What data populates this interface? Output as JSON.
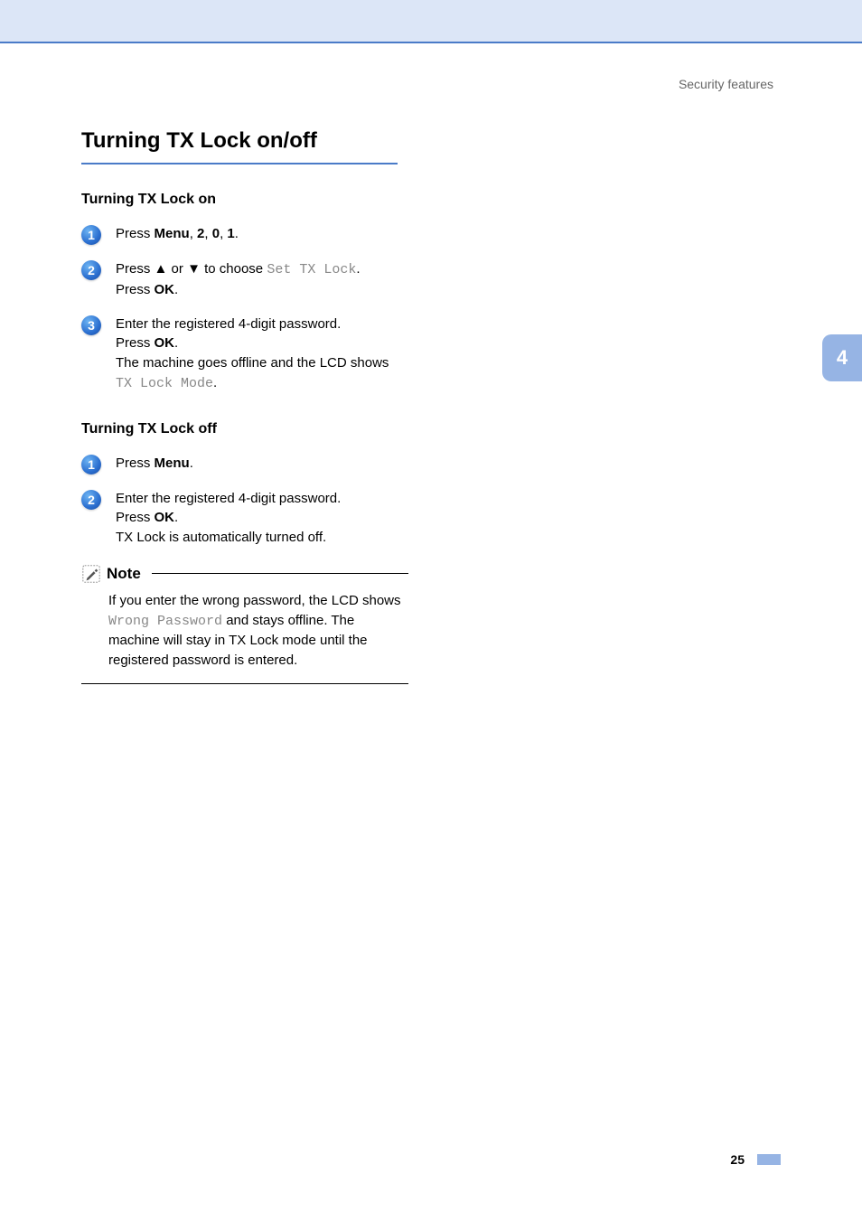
{
  "breadcrumb": "Security features",
  "mainHeading": "Turning TX Lock on/off",
  "sectionOn": {
    "heading": "Turning TX Lock on",
    "steps": [
      {
        "num": "1",
        "parts": [
          {
            "t": "Press "
          },
          {
            "b": "Menu"
          },
          {
            "t": ", "
          },
          {
            "b": "2"
          },
          {
            "t": ", "
          },
          {
            "b": "0"
          },
          {
            "t": ", "
          },
          {
            "b": "1"
          },
          {
            "t": "."
          }
        ]
      },
      {
        "num": "2",
        "parts": [
          {
            "t": "Press "
          },
          {
            "b": "▲"
          },
          {
            "t": " or "
          },
          {
            "b": "▼"
          },
          {
            "t": " to choose "
          },
          {
            "m": "Set TX Lock"
          },
          {
            "t": "."
          },
          {
            "br": true
          },
          {
            "t": "Press "
          },
          {
            "b": "OK"
          },
          {
            "t": "."
          }
        ]
      },
      {
        "num": "3",
        "parts": [
          {
            "t": "Enter the registered 4-digit password."
          },
          {
            "br": true
          },
          {
            "t": "Press "
          },
          {
            "b": "OK"
          },
          {
            "t": "."
          },
          {
            "br": true
          },
          {
            "t": "The machine goes offline and the LCD shows "
          },
          {
            "m": "TX Lock Mode"
          },
          {
            "t": "."
          }
        ]
      }
    ]
  },
  "sectionOff": {
    "heading": "Turning TX Lock off",
    "steps": [
      {
        "num": "1",
        "parts": [
          {
            "t": "Press "
          },
          {
            "b": "Menu"
          },
          {
            "t": "."
          }
        ]
      },
      {
        "num": "2",
        "parts": [
          {
            "t": "Enter the registered 4-digit password."
          },
          {
            "br": true
          },
          {
            "t": "Press "
          },
          {
            "b": "OK"
          },
          {
            "t": "."
          },
          {
            "br": true
          },
          {
            "t": "TX Lock is automatically turned off."
          }
        ]
      }
    ]
  },
  "note": {
    "title": "Note",
    "parts": [
      {
        "t": "If you enter the wrong password, the LCD shows "
      },
      {
        "m": "Wrong Password"
      },
      {
        "t": " and stays offline. The machine will stay in TX Lock mode until the registered password is entered."
      }
    ]
  },
  "chapterTab": "4",
  "pageNumber": "25"
}
